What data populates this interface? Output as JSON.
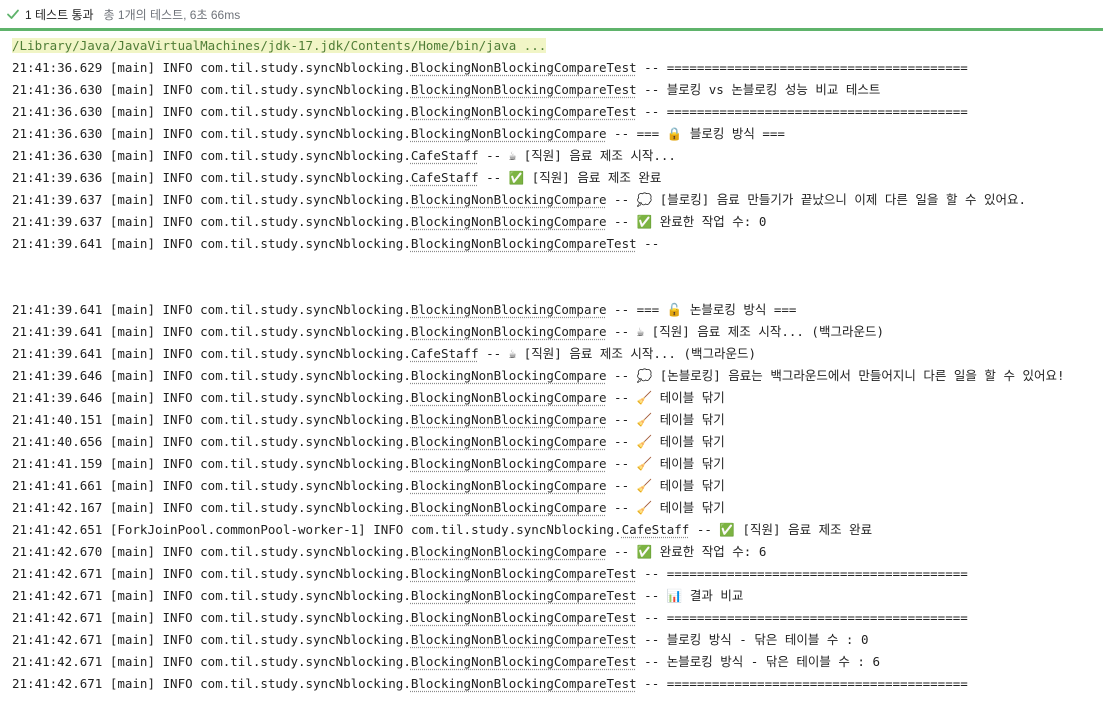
{
  "test_status": {
    "pass_label": "1 테스트 통과",
    "summary": "총 1개의 테스트, 6초 66ms"
  },
  "console": {
    "command": "/Library/Java/JavaVirtualMachines/jdk-17.jdk/Contents/Home/bin/java ...",
    "lines": [
      {
        "prefix": "21:41:36.629 [main] INFO com.til.study.syncNblocking.",
        "cls": "BlockingNonBlockingCompareTest",
        "msg": " -- ========================================"
      },
      {
        "prefix": "21:41:36.630 [main] INFO com.til.study.syncNblocking.",
        "cls": "BlockingNonBlockingCompareTest",
        "msg": " -- 블로킹 vs 논블로킹 성능 비교 테스트"
      },
      {
        "prefix": "21:41:36.630 [main] INFO com.til.study.syncNblocking.",
        "cls": "BlockingNonBlockingCompareTest",
        "msg": " -- ========================================"
      },
      {
        "prefix": "21:41:36.630 [main] INFO com.til.study.syncNblocking.",
        "cls": "BlockingNonBlockingCompare",
        "msg": " -- === 🔒 블로킹 방식 ==="
      },
      {
        "prefix": "21:41:36.630 [main] INFO com.til.study.syncNblocking.",
        "cls": "CafeStaff",
        "msg": " -- ☕ [직원] 음료 제조 시작..."
      },
      {
        "prefix": "21:41:39.636 [main] INFO com.til.study.syncNblocking.",
        "cls": "CafeStaff",
        "msg": " -- ✅ [직원] 음료 제조 완료"
      },
      {
        "prefix": "21:41:39.637 [main] INFO com.til.study.syncNblocking.",
        "cls": "BlockingNonBlockingCompare",
        "msg": " -- 💭 [블로킹] 음료 만들기가 끝났으니 이제 다른 일을 할 수 있어요."
      },
      {
        "prefix": "21:41:39.637 [main] INFO com.til.study.syncNblocking.",
        "cls": "BlockingNonBlockingCompare",
        "msg": " -- ✅ 완료한 작업 수: 0"
      },
      {
        "prefix": "21:41:39.641 [main] INFO com.til.study.syncNblocking.",
        "cls": "BlockingNonBlockingCompareTest",
        "msg": " --"
      },
      {
        "prefix": "",
        "cls": "",
        "msg": ""
      },
      {
        "prefix": "",
        "cls": "",
        "msg": ""
      },
      {
        "prefix": "21:41:39.641 [main] INFO com.til.study.syncNblocking.",
        "cls": "BlockingNonBlockingCompare",
        "msg": " -- === 🔓 논블로킹 방식 ==="
      },
      {
        "prefix": "21:41:39.641 [main] INFO com.til.study.syncNblocking.",
        "cls": "BlockingNonBlockingCompare",
        "msg": " -- ☕ [직원] 음료 제조 시작... (백그라운드)"
      },
      {
        "prefix": "21:41:39.641 [main] INFO com.til.study.syncNblocking.",
        "cls": "CafeStaff",
        "msg": " -- ☕ [직원] 음료 제조 시작... (백그라운드)"
      },
      {
        "prefix": "21:41:39.646 [main] INFO com.til.study.syncNblocking.",
        "cls": "BlockingNonBlockingCompare",
        "msg": " -- 💭 [논블로킹] 음료는 백그라운드에서 만들어지니 다른 일을 할 수 있어요!"
      },
      {
        "prefix": "21:41:39.646 [main] INFO com.til.study.syncNblocking.",
        "cls": "BlockingNonBlockingCompare",
        "msg": " -- 🧹 테이블 닦기"
      },
      {
        "prefix": "21:41:40.151 [main] INFO com.til.study.syncNblocking.",
        "cls": "BlockingNonBlockingCompare",
        "msg": " -- 🧹 테이블 닦기"
      },
      {
        "prefix": "21:41:40.656 [main] INFO com.til.study.syncNblocking.",
        "cls": "BlockingNonBlockingCompare",
        "msg": " -- 🧹 테이블 닦기"
      },
      {
        "prefix": "21:41:41.159 [main] INFO com.til.study.syncNblocking.",
        "cls": "BlockingNonBlockingCompare",
        "msg": " -- 🧹 테이블 닦기"
      },
      {
        "prefix": "21:41:41.661 [main] INFO com.til.study.syncNblocking.",
        "cls": "BlockingNonBlockingCompare",
        "msg": " -- 🧹 테이블 닦기"
      },
      {
        "prefix": "21:41:42.167 [main] INFO com.til.study.syncNblocking.",
        "cls": "BlockingNonBlockingCompare",
        "msg": " -- 🧹 테이블 닦기"
      },
      {
        "prefix": "21:41:42.651 [ForkJoinPool.commonPool-worker-1] INFO com.til.study.syncNblocking.",
        "cls": "CafeStaff",
        "msg": " -- ✅ [직원] 음료 제조 완료"
      },
      {
        "prefix": "21:41:42.670 [main] INFO com.til.study.syncNblocking.",
        "cls": "BlockingNonBlockingCompare",
        "msg": " -- ✅ 완료한 작업 수: 6"
      },
      {
        "prefix": "21:41:42.671 [main] INFO com.til.study.syncNblocking.",
        "cls": "BlockingNonBlockingCompareTest",
        "msg": " -- ========================================"
      },
      {
        "prefix": "21:41:42.671 [main] INFO com.til.study.syncNblocking.",
        "cls": "BlockingNonBlockingCompareTest",
        "msg": " -- 📊 결과 비교"
      },
      {
        "prefix": "21:41:42.671 [main] INFO com.til.study.syncNblocking.",
        "cls": "BlockingNonBlockingCompareTest",
        "msg": " -- ========================================"
      },
      {
        "prefix": "21:41:42.671 [main] INFO com.til.study.syncNblocking.",
        "cls": "BlockingNonBlockingCompareTest",
        "msg": " -- 블로킹 방식 - 닦은 테이블 수 : 0"
      },
      {
        "prefix": "21:41:42.671 [main] INFO com.til.study.syncNblocking.",
        "cls": "BlockingNonBlockingCompareTest",
        "msg": " -- 논블로킹 방식 - 닦은 테이블 수 : 6"
      },
      {
        "prefix": "21:41:42.671 [main] INFO com.til.study.syncNblocking.",
        "cls": "BlockingNonBlockingCompareTest",
        "msg": " -- ========================================"
      }
    ]
  },
  "colors": {
    "pass_green": "#5fb36b",
    "command_text": "#4f7d36",
    "command_highlight": "#f1f5c6"
  },
  "icons": {
    "status": "check-icon"
  }
}
